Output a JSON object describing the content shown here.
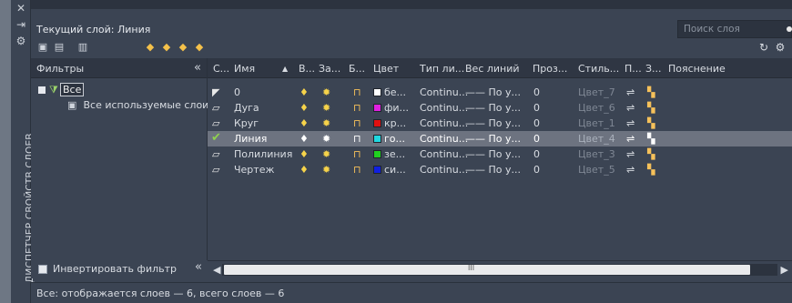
{
  "palette_title": "ДИСПЕТЧЕР СВОЙСТВ СЛОЕВ",
  "current_layer_label": "Текущий слой: Линия",
  "search": {
    "placeholder": "Поиск слоя"
  },
  "filters": {
    "header": "Фильтры",
    "collapse": "«",
    "tree": [
      {
        "label": "Все"
      },
      {
        "label": "Все используемые слои"
      }
    ],
    "invert_label": "Инвертировать фильтр",
    "invert_collapse": "«"
  },
  "columns": [
    "С...",
    "Имя",
    "В...",
    "За...",
    "Б...",
    "Цвет",
    "Тип ли...",
    "Вес линий",
    "Проз...",
    "Стиль...",
    "П...",
    "З...",
    "Пояснение"
  ],
  "layers": [
    {
      "name": "0",
      "color_name": "бе...",
      "color": "#ffffff",
      "linetype": "Continu...",
      "lineweight": "—— По у...",
      "transparency": "0",
      "plotstyle": "Цвет_7",
      "current": false
    },
    {
      "name": "Дуга",
      "color_name": "фи...",
      "color": "#e020e0",
      "linetype": "Continu...",
      "lineweight": "—— По у...",
      "transparency": "0",
      "plotstyle": "Цвет_6",
      "current": false
    },
    {
      "name": "Круг",
      "color_name": "кр...",
      "color": "#e01010",
      "linetype": "Continu...",
      "lineweight": "—— По у...",
      "transparency": "0",
      "plotstyle": "Цвет_1",
      "current": false
    },
    {
      "name": "Линия",
      "color_name": "го...",
      "color": "#20d8e0",
      "linetype": "Continu...",
      "lineweight": "—— По у...",
      "transparency": "0",
      "plotstyle": "Цвет_4",
      "current": true
    },
    {
      "name": "Полилиния",
      "color_name": "зе...",
      "color": "#20d020",
      "linetype": "Continu...",
      "lineweight": "—— По у...",
      "transparency": "0",
      "plotstyle": "Цвет_3",
      "current": false
    },
    {
      "name": "Чертеж",
      "color_name": "си...",
      "color": "#1020e0",
      "linetype": "Continu...",
      "lineweight": "—— По у...",
      "transparency": "0",
      "plotstyle": "Цвет_5",
      "current": false
    }
  ],
  "scroll_grip": "III",
  "status_text": "Все: отображается слоев — 6, всего слоев — 6"
}
